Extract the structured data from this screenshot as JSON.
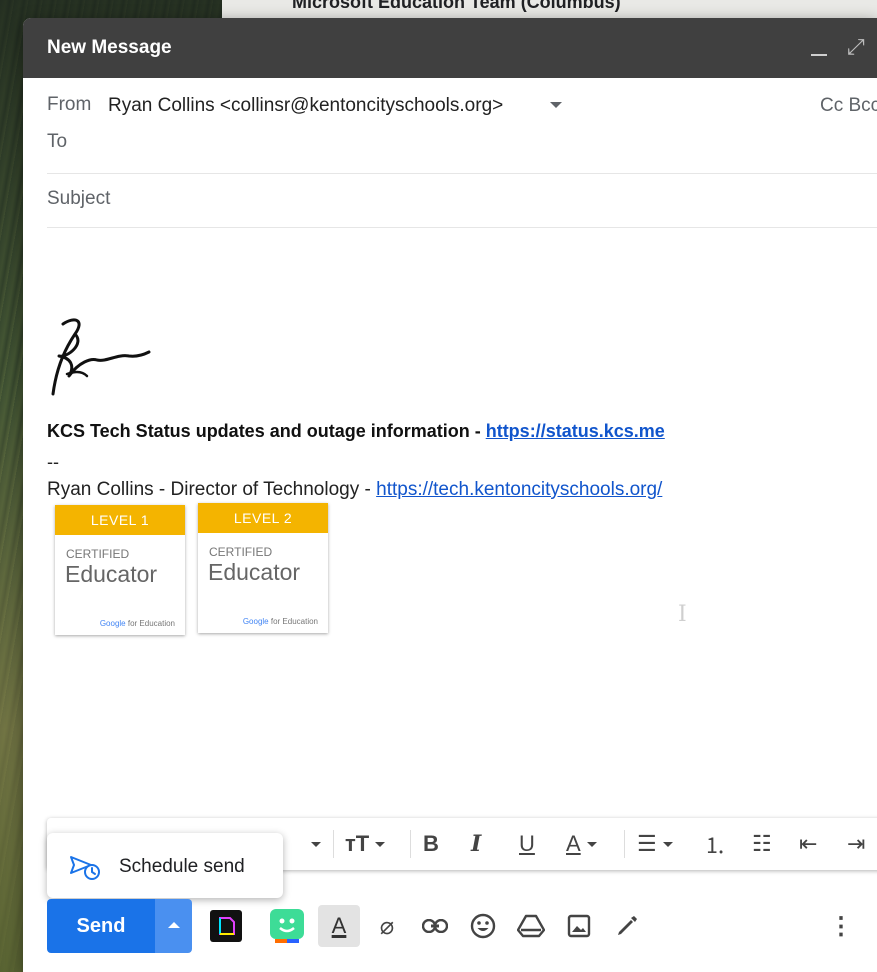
{
  "background": {
    "card_title": "Microsoft Education Team (Columbus)"
  },
  "compose": {
    "title": "New Message",
    "from_label": "From",
    "from_value": "Ryan Collins <collinsr@kentoncityschools.org>",
    "cc_bcc": "Cc Bcc",
    "to_label": "To",
    "subject_label": "Subject"
  },
  "signature": {
    "status_text": "KCS Tech Status updates and outage information - ",
    "status_link": "https://status.kcs.me",
    "dash": "--",
    "name_title": "Ryan Collins - Director of Technology - ",
    "tech_link": "https://tech.kentoncityschools.org/",
    "badges": [
      {
        "level": "LEVEL 1",
        "certified": "CERTIFIED",
        "title": "Educator",
        "footer": "Google for Education"
      },
      {
        "level": "LEVEL 2",
        "certified": "CERTIFIED",
        "title": "Educator",
        "footer": "Google for Education"
      }
    ]
  },
  "schedule_popup": {
    "label": "Schedule send"
  },
  "toolbar": {
    "send_label": "Send",
    "format_icons": [
      "font-size-icon",
      "bold-icon",
      "italic-icon",
      "underline-icon",
      "text-color-icon",
      "align-icon",
      "numbered-list-icon",
      "bulleted-list-icon",
      "indent-less-icon",
      "indent-more-icon"
    ],
    "bottom_icons": [
      "nimbus-app-icon",
      "bitmoji-app-icon",
      "formatting-options-icon",
      "attach-icon",
      "link-icon",
      "emoji-icon",
      "drive-icon",
      "photo-icon",
      "signature-icon",
      "more-options-icon"
    ]
  },
  "colors": {
    "send": "#1a73e8",
    "header": "#404040",
    "badge_gold": "#f4b400",
    "link": "#1155cc"
  }
}
